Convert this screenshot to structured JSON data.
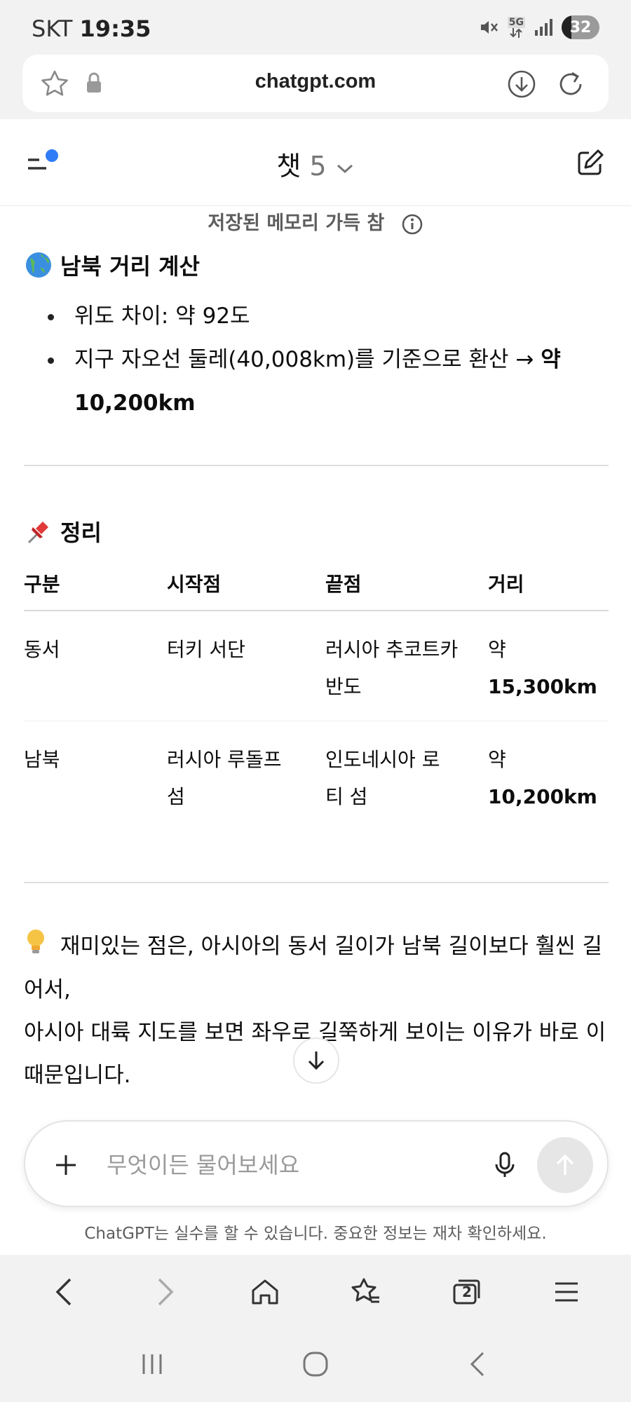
{
  "status_bar": {
    "carrier": "SKT",
    "time": "19:35",
    "network": "5G",
    "battery": "32"
  },
  "browser": {
    "url": "chatgpt.com"
  },
  "header": {
    "title": "챗",
    "version": "5"
  },
  "conversation": {
    "memory_note": "저장된 메모리 가득 참",
    "ns_heading": "남북 거리 계산",
    "bullets": [
      {
        "text": "위도 차이: 약 92도",
        "bold": ""
      },
      {
        "text": "지구 자오선 둘레(40,008km)를 기준으로 환산 → ",
        "bold": "약 10,200km"
      }
    ],
    "summary_heading": "정리",
    "table": {
      "headers": [
        "구분",
        "시작점",
        "끝점",
        "거리"
      ],
      "rows": [
        {
          "type": "동서",
          "start": "터키 서단",
          "end": "러시아 추코트카 반도",
          "dist_prefix": "약",
          "dist": "15,300km"
        },
        {
          "type": "남북",
          "start": "러시아 루돌프 섬",
          "end": "인도네시아 로티 섬",
          "dist_prefix": "약",
          "dist": "10,200km"
        }
      ]
    },
    "closing_line1": "재미있는 점은, 아시아의 동서 길이가 남북 길이보다 훨씬 길어서,",
    "closing_line2": "아시아 대륙 지도를 보면 좌우로 길쭉하게 보이는 이유가 바로 이 때문입니다."
  },
  "composer": {
    "placeholder": "무엇이든 물어보세요"
  },
  "disclaimer": "ChatGPT는 실수를 할 수 있습니다. 중요한 정보는 재차 확인하세요.",
  "bottom_nav": {
    "tabs_count": "2"
  },
  "colors": {
    "accent_dot": "#2f7cf6",
    "send_disabled": "#e6e6e6"
  }
}
